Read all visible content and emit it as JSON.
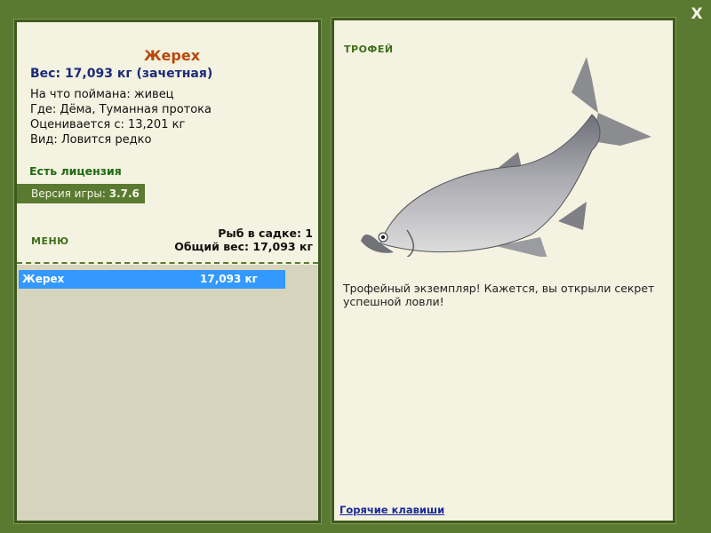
{
  "window": {
    "close_label": "X"
  },
  "fish": {
    "name": "Жерех",
    "weight_line": "Вес: 17,093 кг (зачетная)",
    "caught_on": "На что поймана: живец",
    "location": "Где: Дёма, Туманная протока",
    "rated_from": "Оценивается с: 13,201 кг",
    "species_note": "Вид: Ловится редко"
  },
  "license": "Есть лицензия",
  "version": {
    "label": "Версия игры: ",
    "value": "3.7.6"
  },
  "menu_label": "МЕНЮ",
  "cage": {
    "count_line": "Рыб в садке: 1",
    "total_line": "Общий вес: 17,093 кг",
    "rows": [
      {
        "name": "Жерех",
        "weight": "17,093 кг"
      }
    ]
  },
  "trophy": {
    "title": "ТРОФЕЙ",
    "text": "Трофейный экземпляр! Кажется, вы открыли секрет успешной ловли!"
  },
  "hotkeys_link": "Горячие клавиши",
  "colors": {
    "frame": "#5a7a32",
    "panel": "#f4f2e0",
    "selected_row": "#3399ff"
  }
}
